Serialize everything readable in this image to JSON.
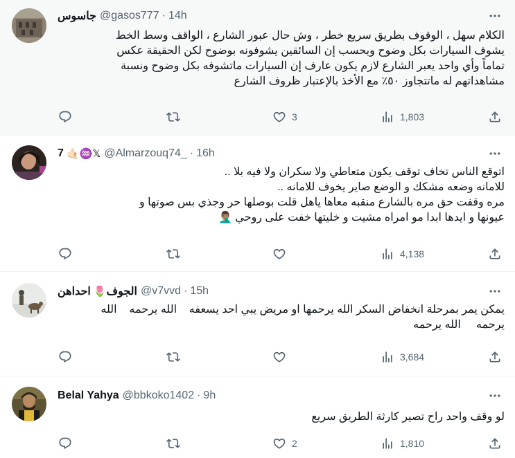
{
  "tweets": [
    {
      "name": "جاسوس",
      "emoji": "",
      "handle": "@gasos777",
      "time": "14h",
      "lines": [
        "الكلام سهل ، الوقوف بطريق سريع خطر ، وش حال عبور الشارع ، الواقف وسط الخط",
        "يشوف السيارات بكل وضوح ويحسب إن السائقين يشوفونه بوضوح لكن الحقيقة عكس",
        "تماماً وأي واحد يعبر الشارع لازم يكون عارف إن السيارات ماتشوفه بكل وضوح ونسبة",
        "مشاهداتهم له ماتتجاوز ٥٠٪ مع الأخذ بالإعتبار ظروف الشارع"
      ],
      "replies": "",
      "retweets": "",
      "likes": "3",
      "views": "1,803"
    },
    {
      "name": "7",
      "emoji": "🤙🏻♒𝕏",
      "handle": "@Almarzouq74_",
      "time": "16h",
      "lines": [
        "اتوقع الناس تخاف توقف يكون متعاطي ولا سكران ولا فيه بلا ..",
        "للامانه وضعه مشكك و الوضع صاير يخوف للامانه ..",
        "مره وقفت حق مره بالشارع منقبه معاها ياهل قلت بوصلها حر وجذي بس صوتها و",
        "عيونها و ايدها ابدا مو امراه مشيت و خليتها خفت على روحي 🤦🏽‍♂️"
      ],
      "replies": "",
      "retweets": "",
      "likes": "",
      "views": "4,138"
    },
    {
      "name": "احداهن",
      "emoji": "🌷",
      "name2": "الجوف",
      "handle": "@v7vvd",
      "time": "15h",
      "lines": [
        "يمكن يمر بمرحلة انخفاض السكر الله يرحمها او مريض يبي احد يسعفه    الله يرحمه    الله",
        "يرحمه     الله يرحمه"
      ],
      "replies": "",
      "retweets": "",
      "likes": "",
      "views": "3,684"
    },
    {
      "name": "Belal Yahya",
      "emoji": "",
      "handle": "@bbkoko1402",
      "time": "9h",
      "lines": [
        "لو وقف واحد راح تصير كارثة الطريق سريع"
      ],
      "replies": "",
      "retweets": "",
      "likes": "2",
      "views": "1,810"
    }
  ],
  "icons": {
    "more": "more-horizontal-icon",
    "reply": "reply-bubble-icon",
    "retweet": "retweet-icon",
    "like": "heart-icon",
    "views": "views-bar-chart-icon",
    "share": "share-upload-icon"
  },
  "colors": {
    "text": "#0f1419",
    "secondary": "#536471",
    "divider": "#eff3f4",
    "highlight_bg": "#f7f9f9"
  }
}
